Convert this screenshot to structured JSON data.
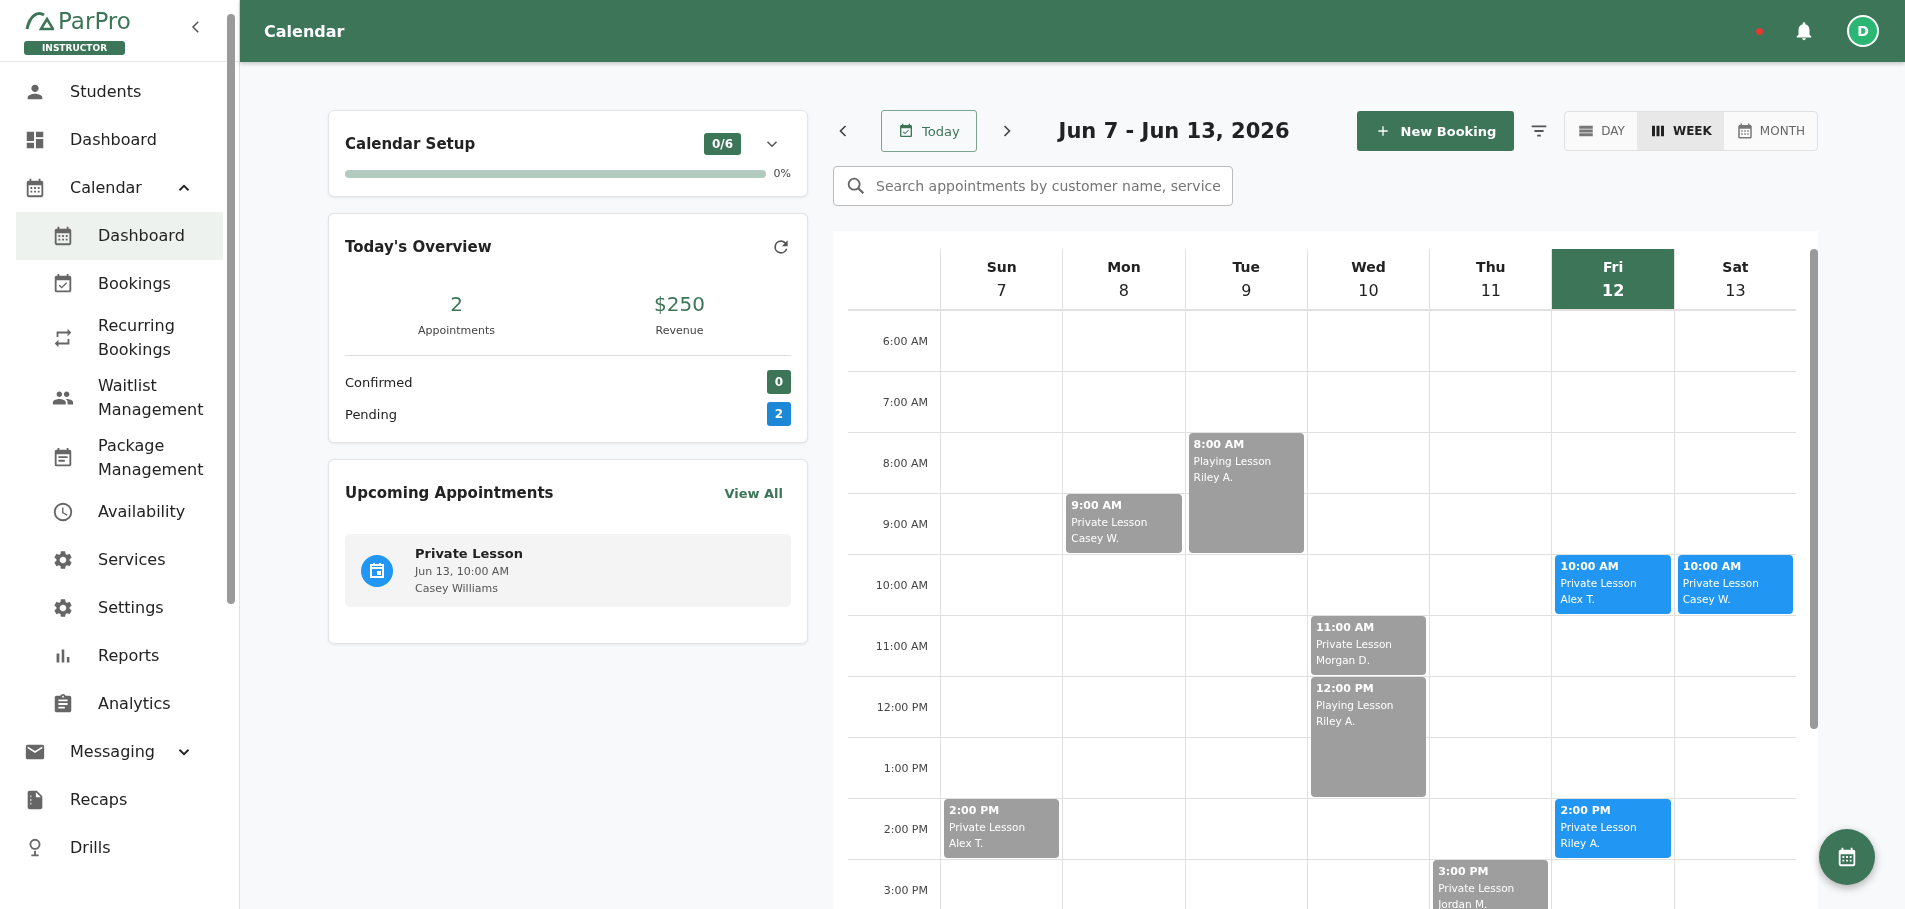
{
  "sidebar": {
    "brand": "ParPro",
    "role_badge": "INSTRUCTOR",
    "items": [
      {
        "label": "Students",
        "selected": false
      },
      {
        "label": "Dashboard",
        "selected": false
      },
      {
        "label": "Calendar",
        "selected": false,
        "expanded": true,
        "children": [
          {
            "label": "Dashboard",
            "selected": true
          },
          {
            "label": "Bookings",
            "selected": false
          },
          {
            "label": "Recurring Bookings",
            "selected": false
          },
          {
            "label": "Waitlist Management",
            "selected": false
          },
          {
            "label": "Package Management",
            "selected": false
          },
          {
            "label": "Availability",
            "selected": false
          },
          {
            "label": "Services",
            "selected": false
          },
          {
            "label": "Settings",
            "selected": false
          },
          {
            "label": "Reports",
            "selected": false
          },
          {
            "label": "Analytics",
            "selected": false
          }
        ]
      },
      {
        "label": "Messaging",
        "selected": false,
        "expanded": false
      },
      {
        "label": "Recaps",
        "selected": false
      },
      {
        "label": "Drills",
        "selected": false
      }
    ]
  },
  "topbar": {
    "title": "Calendar",
    "notification_dot": true,
    "avatar": "D"
  },
  "setup": {
    "title": "Calendar Setup",
    "badge": "0/6",
    "level": 0,
    "percent": "0%"
  },
  "overview": {
    "title": "Today's Overview",
    "stats": [
      {
        "value": "2",
        "label": "Appointments"
      },
      {
        "value": "$250",
        "label": "Revenue"
      }
    ],
    "statuses": [
      {
        "label": "Confirmed",
        "count": "0",
        "color": "#3d7558"
      },
      {
        "label": "Pending",
        "count": "2",
        "color": "#1e88d8"
      }
    ]
  },
  "upcoming": {
    "title": "Upcoming Appointments",
    "link": "View All",
    "items": [
      {
        "title": "Private Lesson",
        "when": "Jun 13, 10:00 AM",
        "customer": "Casey Williams"
      }
    ]
  },
  "toolbar": {
    "today": "Today",
    "range": "Jun 7 - Jun 13, 2026",
    "new_booking": "New Booking",
    "views": [
      {
        "label": "DAY",
        "selected": false
      },
      {
        "label": "WEEK",
        "selected": true
      },
      {
        "label": "MONTH",
        "selected": false
      }
    ]
  },
  "search": {
    "placeholder": "Search appointments by customer name, service"
  },
  "calendar": {
    "days": [
      {
        "name": "Sun",
        "date": "7",
        "selected": false
      },
      {
        "name": "Mon",
        "date": "8",
        "selected": false
      },
      {
        "name": "Tue",
        "date": "9",
        "selected": false
      },
      {
        "name": "Wed",
        "date": "10",
        "selected": false
      },
      {
        "name": "Thu",
        "date": "11",
        "selected": false
      },
      {
        "name": "Fri",
        "date": "12",
        "selected": true
      },
      {
        "name": "Sat",
        "date": "13",
        "selected": false
      }
    ],
    "rows": [
      {
        "time": "6:00 AM",
        "cells": [
          null,
          null,
          null,
          null,
          null,
          null,
          null
        ]
      },
      {
        "time": "7:00 AM",
        "cells": [
          null,
          null,
          null,
          null,
          null,
          null,
          null
        ]
      },
      {
        "time": "8:00 AM",
        "cells": [
          null,
          null,
          {
            "time": "8:00 AM",
            "title": "Playing Lesson",
            "customer": "Riley A.",
            "color": "#9e9e9e",
            "kind": "double"
          },
          null,
          null,
          null,
          null
        ]
      },
      {
        "time": "9:00 AM",
        "cells": [
          null,
          {
            "time": "9:00 AM",
            "title": "Private Lesson",
            "customer": "Casey W.",
            "color": "#9e9e9e",
            "kind": "single"
          },
          null,
          null,
          null,
          null,
          null
        ]
      },
      {
        "time": "10:00 AM",
        "cells": [
          null,
          null,
          null,
          null,
          null,
          {
            "time": "10:00 AM",
            "title": "Private Lesson",
            "customer": "Alex T.",
            "color": "#2196f3",
            "kind": "single"
          },
          {
            "time": "10:00 AM",
            "title": "Private Lesson",
            "customer": "Casey W.",
            "color": "#2196f3",
            "kind": "single"
          }
        ]
      },
      {
        "time": "11:00 AM",
        "cells": [
          null,
          null,
          null,
          {
            "time": "11:00 AM",
            "title": "Private Lesson",
            "customer": "Morgan D.",
            "color": "#9e9e9e",
            "kind": "single"
          },
          null,
          null,
          null
        ]
      },
      {
        "time": "12:00 PM",
        "cells": [
          null,
          null,
          null,
          {
            "time": "12:00 PM",
            "title": "Playing Lesson",
            "customer": "Riley A.",
            "color": "#9e9e9e",
            "kind": "double"
          },
          null,
          null,
          null
        ]
      },
      {
        "time": "1:00 PM",
        "cells": [
          null,
          null,
          null,
          null,
          null,
          null,
          null
        ]
      },
      {
        "time": "2:00 PM",
        "cells": [
          {
            "time": "2:00 PM",
            "title": "Private Lesson",
            "customer": "Alex T.",
            "color": "#9e9e9e",
            "kind": "single"
          },
          null,
          null,
          null,
          null,
          {
            "time": "2:00 PM",
            "title": "Private Lesson",
            "customer": "Riley A.",
            "color": "#2196f3",
            "kind": "single"
          },
          null
        ]
      },
      {
        "time": "3:00 PM",
        "cells": [
          null,
          null,
          null,
          null,
          {
            "time": "3:00 PM",
            "title": "Private Lesson",
            "customer": "Jordan M.",
            "color": "#9e9e9e",
            "kind": "single"
          },
          null,
          null
        ]
      }
    ]
  }
}
